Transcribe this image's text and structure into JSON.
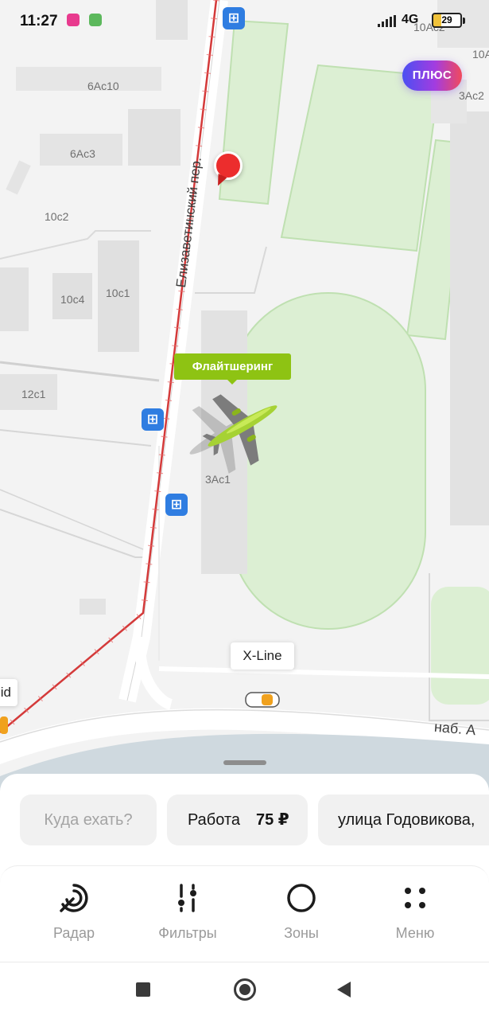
{
  "status_bar": {
    "time": "11:27",
    "network": "4G",
    "battery": "29"
  },
  "map": {
    "plus_badge": "ПЛЮС",
    "street_name": "Елизаветинский пер.",
    "embankment": "наб. А",
    "flight_tag": "Флайтшеринг",
    "xline_tag": "X-Line",
    "left_tag": "id",
    "buildings": [
      "6Ас10",
      "6Ас3",
      "10с2",
      "10с4",
      "10с1",
      "12с1",
      "3Ас1",
      "10Ас2",
      "10А",
      "3Ас2"
    ]
  },
  "search": {
    "where_to": "Куда ехать?",
    "work_label": "Работа",
    "work_price": "75 ₽",
    "street_suggestion": "улица Годовикова,"
  },
  "nav": {
    "items": [
      {
        "label": "Радар",
        "icon": "radar-icon"
      },
      {
        "label": "Фильтры",
        "icon": "filters-icon"
      },
      {
        "label": "Зоны",
        "icon": "zones-icon"
      },
      {
        "label": "Меню",
        "icon": "menu-dots-icon"
      }
    ]
  },
  "colors": {
    "flight_tag": "#8ec313",
    "pin": "#ec2d2d",
    "transit": "#2f7de1",
    "field": "#dcefd3",
    "water": "#cfd9df"
  }
}
